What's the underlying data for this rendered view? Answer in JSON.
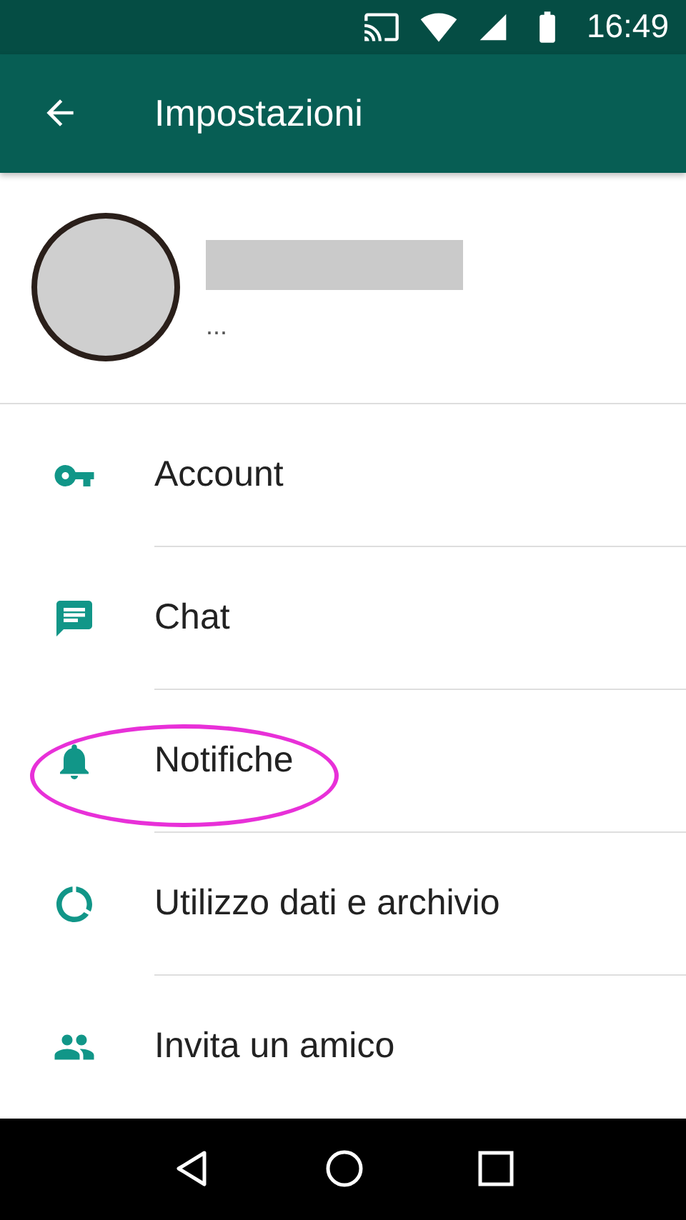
{
  "status_bar": {
    "time": "16:49"
  },
  "app_bar": {
    "title": "Impostazioni"
  },
  "profile": {
    "status": "..."
  },
  "items": [
    {
      "label": "Account",
      "highlighted": false
    },
    {
      "label": "Chat",
      "highlighted": false
    },
    {
      "label": "Notifiche",
      "highlighted": true
    },
    {
      "label": "Utilizzo dati e archivio",
      "highlighted": false
    },
    {
      "label": "Invita un amico",
      "highlighted": false
    }
  ]
}
